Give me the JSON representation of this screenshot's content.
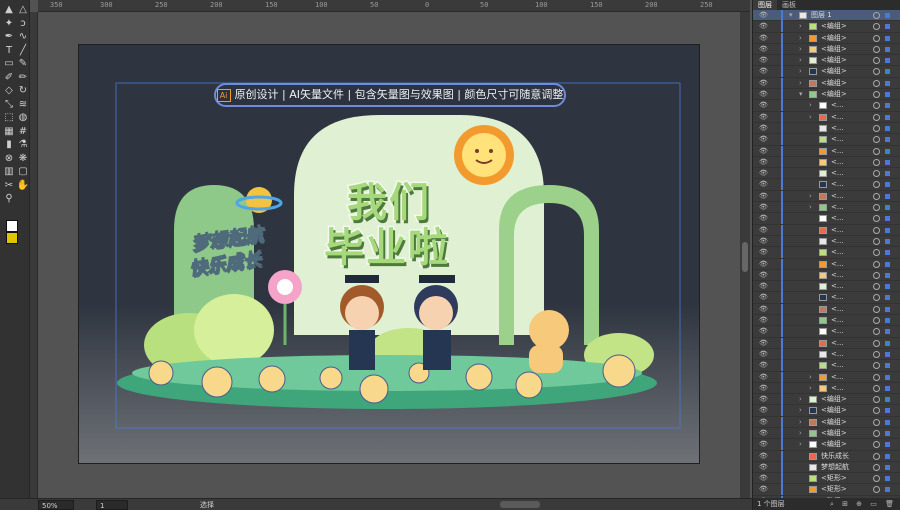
{
  "ruler": {
    "ticks": [
      "350",
      "300",
      "250",
      "200",
      "150",
      "100",
      "50",
      "0",
      "50",
      "100",
      "150",
      "200",
      "250"
    ]
  },
  "toolbar": {
    "tools": [
      "selection-tool",
      "direct-selection-tool",
      "magic-wand-tool",
      "lasso-tool",
      "pen-tool",
      "curvature-tool",
      "type-tool",
      "line-tool",
      "rectangle-tool",
      "paintbrush-tool",
      "shaper-tool",
      "pencil-tool",
      "eraser-tool",
      "rotate-tool",
      "scale-tool",
      "width-tool",
      "free-transform-tool",
      "shape-builder-tool",
      "perspective-grid-tool",
      "mesh-tool",
      "gradient-tool",
      "eyedropper-tool",
      "blend-tool",
      "symbol-sprayer-tool",
      "column-graph-tool",
      "artboard-tool",
      "slice-tool",
      "hand-tool",
      "zoom-tool"
    ]
  },
  "artwork": {
    "banner": {
      "badge": "Ai",
      "text": "原创设计 | AI矢量文件 | 包含矢量图与效果图 | 颜色尺寸可随意调整"
    },
    "title_line1": "我们",
    "title_line2": "毕业啦",
    "slogan_line1": "梦想起航",
    "slogan_line2": "快乐成长"
  },
  "statusbar": {
    "zoom": "50%",
    "artboard_number": "1",
    "tool_name": "选择"
  },
  "panel": {
    "tabs": [
      "图层",
      "画板"
    ],
    "layers": [
      {
        "name": "图层 1",
        "indent": 0,
        "expanded": true,
        "top": true
      },
      {
        "name": "<编组>",
        "indent": 1,
        "arrow": true
      },
      {
        "name": "<编组>",
        "indent": 1,
        "arrow": true
      },
      {
        "name": "<编组>",
        "indent": 1,
        "arrow": true
      },
      {
        "name": "<编组>",
        "indent": 1,
        "arrow": true
      },
      {
        "name": "<编组>",
        "indent": 1,
        "arrow": true
      },
      {
        "name": "<编组>",
        "indent": 1,
        "arrow": true
      },
      {
        "name": "<编组>",
        "indent": 1,
        "expanded": true
      },
      {
        "name": "<...",
        "indent": 2,
        "arrow": true
      },
      {
        "name": "<...",
        "indent": 2,
        "arrow": true
      },
      {
        "name": "<...",
        "indent": 2
      },
      {
        "name": "<...",
        "indent": 2
      },
      {
        "name": "<...",
        "indent": 2
      },
      {
        "name": "<...",
        "indent": 2
      },
      {
        "name": "<...",
        "indent": 2
      },
      {
        "name": "<...",
        "indent": 2
      },
      {
        "name": "<...",
        "indent": 2,
        "arrow": true
      },
      {
        "name": "<...",
        "indent": 2,
        "arrow": true
      },
      {
        "name": "<...",
        "indent": 2
      },
      {
        "name": "<...",
        "indent": 2
      },
      {
        "name": "<...",
        "indent": 2
      },
      {
        "name": "<...",
        "indent": 2
      },
      {
        "name": "<...",
        "indent": 2
      },
      {
        "name": "<...",
        "indent": 2
      },
      {
        "name": "<...",
        "indent": 2
      },
      {
        "name": "<...",
        "indent": 2
      },
      {
        "name": "<...",
        "indent": 2
      },
      {
        "name": "<...",
        "indent": 2
      },
      {
        "name": "<...",
        "indent": 2
      },
      {
        "name": "<...",
        "indent": 2
      },
      {
        "name": "<...",
        "indent": 2
      },
      {
        "name": "<...",
        "indent": 2
      },
      {
        "name": "<...",
        "indent": 2,
        "arrow": true
      },
      {
        "name": "<...",
        "indent": 2,
        "arrow": true
      },
      {
        "name": "<编组>",
        "indent": 1,
        "arrow": true
      },
      {
        "name": "<编组>",
        "indent": 1,
        "arrow": true
      },
      {
        "name": "<编组>",
        "indent": 1,
        "arrow": true
      },
      {
        "name": "<编组>",
        "indent": 1,
        "arrow": true
      },
      {
        "name": "<编组>",
        "indent": 1,
        "arrow": true
      },
      {
        "name": "快乐成长",
        "indent": 1
      },
      {
        "name": "梦想起航",
        "indent": 1
      },
      {
        "name": "<矩形>",
        "indent": 1
      },
      {
        "name": "<矩形>",
        "indent": 1
      },
      {
        "name": "<路径>",
        "indent": 1
      }
    ],
    "footer_label": "1 个图层"
  },
  "colors": {
    "accent_green": "#a6d97c",
    "selection_blue": "#4a7ad6",
    "banner_border": "#6f8bd9",
    "sun_orange": "#f29a2e"
  }
}
